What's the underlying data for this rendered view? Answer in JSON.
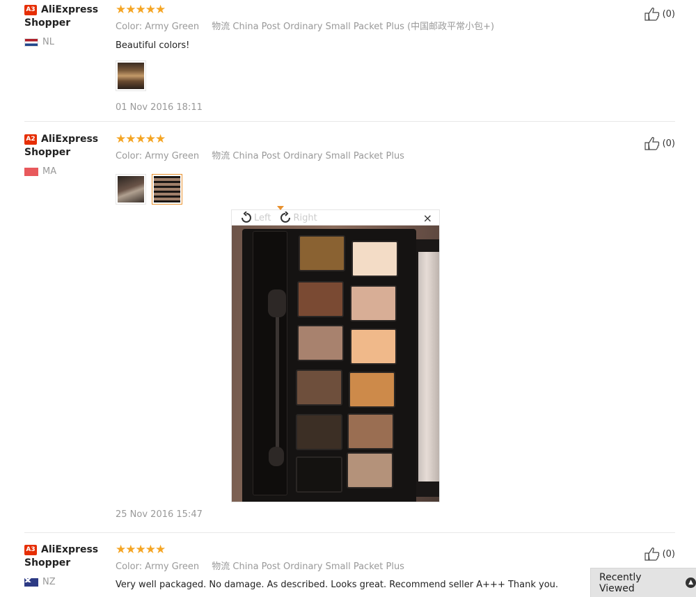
{
  "reviews": [
    {
      "badge": "A3",
      "user_line1": "AliExpress",
      "user_line2": "Shopper",
      "country": "NL",
      "stars": "★★★★★",
      "color_label": "Color:",
      "color_value": "Army Green",
      "logistics_label": "物流",
      "logistics_value": "China Post Ordinary Small Packet Plus (中国邮政平常小包+)",
      "text": "Beautiful colors!",
      "date": "01 Nov 2016 18:11",
      "helpful": "(0)"
    },
    {
      "badge": "A2",
      "user_line1": "AliExpress",
      "user_line2": "Shopper",
      "country": "MA",
      "stars": "★★★★★",
      "color_label": "Color:",
      "color_value": "Army Green",
      "logistics_label": "物流",
      "logistics_value": "China Post Ordinary Small Packet Plus",
      "date": "25 Nov 2016 15:47",
      "helpful": "(0)"
    },
    {
      "badge": "A3",
      "user_line1": "AliExpress",
      "user_line2": "Shopper",
      "country": "NZ",
      "stars": "★★★★★",
      "color_label": "Color:",
      "color_value": "Army Green",
      "logistics_label": "物流",
      "logistics_value": "China Post Ordinary Small Packet Plus",
      "text": "Very well packaged. No damage. As described. Looks great. Recommend seller A+++ Thank you.",
      "helpful": "(0)"
    }
  ],
  "viewer": {
    "rotate_left": "Left",
    "rotate_right": "Right",
    "close": "×"
  },
  "recently_viewed": {
    "label": "Recently Viewed",
    "icon": "chevron-up-icon"
  },
  "colors": {
    "star": "#f5a524",
    "badge": "#e62e04",
    "selected_thumb": "#e8912e"
  }
}
